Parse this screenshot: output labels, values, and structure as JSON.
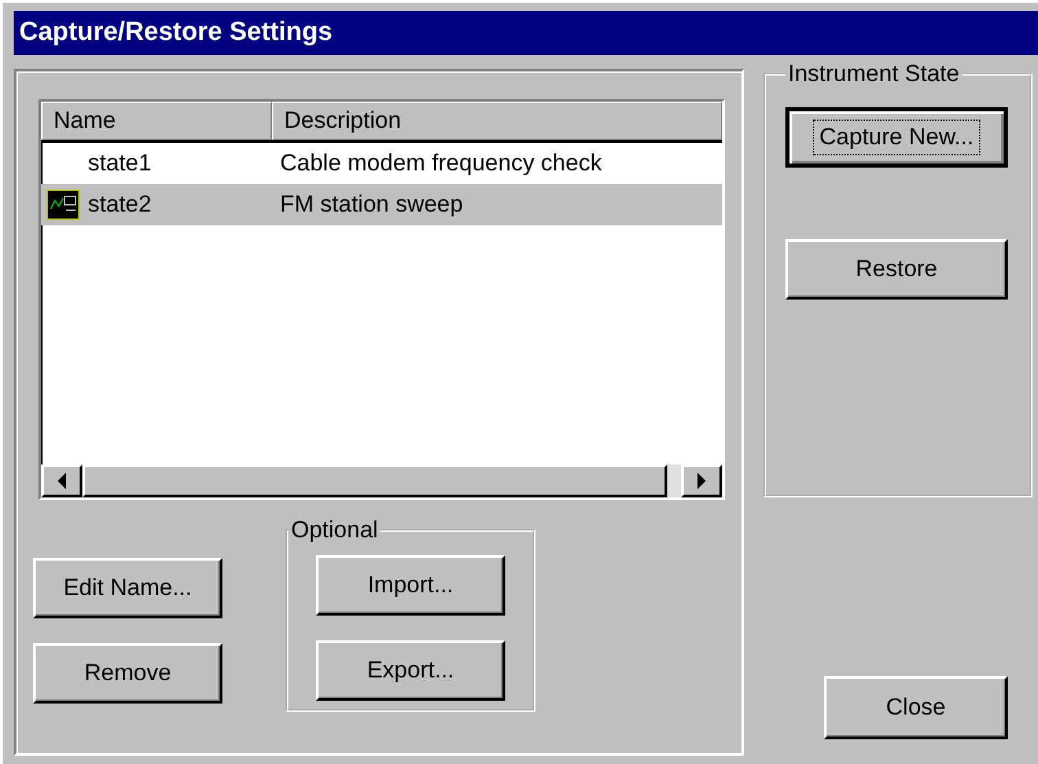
{
  "window": {
    "title": "Capture/Restore Settings"
  },
  "list": {
    "columns": [
      "Name",
      "Description"
    ],
    "rows": [
      {
        "name": "state1",
        "description": "Cable modem frequency check",
        "has_icon": false,
        "selected": false
      },
      {
        "name": "state2",
        "description": "FM station sweep",
        "has_icon": true,
        "selected": true
      }
    ]
  },
  "left_buttons": [
    "Edit Name...",
    "Remove"
  ],
  "optional": {
    "title": "Optional",
    "buttons": [
      "Import...",
      "Export..."
    ]
  },
  "instrument_state": {
    "title": "Instrument State",
    "buttons": [
      {
        "label": "Capture New...",
        "default": true
      },
      {
        "label": "Restore",
        "default": false
      }
    ]
  },
  "close_button": "Close"
}
